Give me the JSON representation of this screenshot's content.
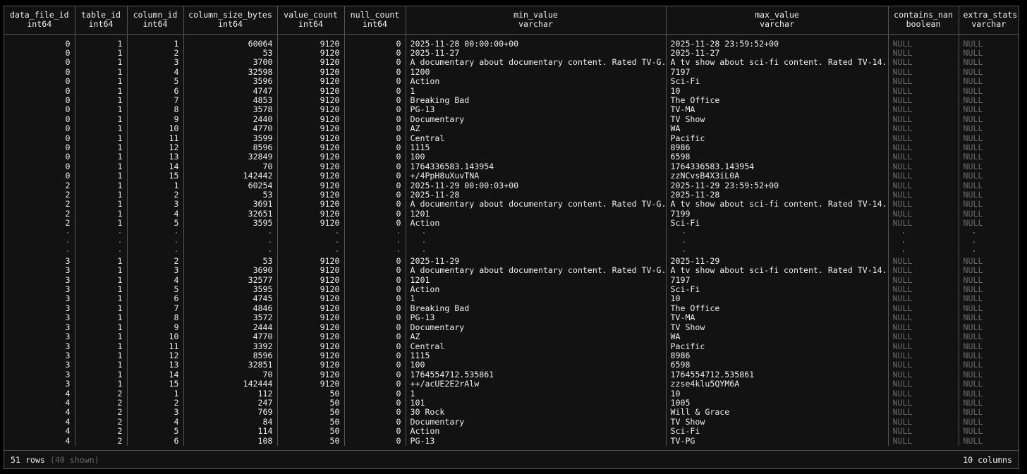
{
  "columns": [
    {
      "name": "data_file_id",
      "type": "int64",
      "align": "num"
    },
    {
      "name": "table_id",
      "type": "int64",
      "align": "num"
    },
    {
      "name": "column_id",
      "type": "int64",
      "align": "num"
    },
    {
      "name": "column_size_bytes",
      "type": "int64",
      "align": "num"
    },
    {
      "name": "value_count",
      "type": "int64",
      "align": "num"
    },
    {
      "name": "null_count",
      "type": "int64",
      "align": "num"
    },
    {
      "name": "min_value",
      "type": "varchar",
      "align": "txt"
    },
    {
      "name": "max_value",
      "type": "varchar",
      "align": "txt"
    },
    {
      "name": "contains_nan",
      "type": "boolean",
      "align": "null"
    },
    {
      "name": "extra_stats",
      "type": "varchar",
      "align": "null"
    }
  ],
  "rows_top": [
    [
      "0",
      "1",
      "1",
      "60064",
      "9120",
      "0",
      "2025-11-28 00:00:00+00",
      "2025-11-28 23:59:52+00",
      "NULL",
      "NULL"
    ],
    [
      "0",
      "1",
      "2",
      "53",
      "9120",
      "0",
      "2025-11-27",
      "2025-11-27",
      "NULL",
      "NULL"
    ],
    [
      "0",
      "1",
      "3",
      "3700",
      "9120",
      "0",
      "A documentary about documentary content. Rated TV-G.",
      "A tv show about sci-fi content. Rated TV-14.",
      "NULL",
      "NULL"
    ],
    [
      "0",
      "1",
      "4",
      "32598",
      "9120",
      "0",
      "1200",
      "7197",
      "NULL",
      "NULL"
    ],
    [
      "0",
      "1",
      "5",
      "3596",
      "9120",
      "0",
      "Action",
      "Sci-Fi",
      "NULL",
      "NULL"
    ],
    [
      "0",
      "1",
      "6",
      "4747",
      "9120",
      "0",
      "1",
      "10",
      "NULL",
      "NULL"
    ],
    [
      "0",
      "1",
      "7",
      "4853",
      "9120",
      "0",
      "Breaking Bad",
      "The Office",
      "NULL",
      "NULL"
    ],
    [
      "0",
      "1",
      "8",
      "3578",
      "9120",
      "0",
      "PG-13",
      "TV-MA",
      "NULL",
      "NULL"
    ],
    [
      "0",
      "1",
      "9",
      "2440",
      "9120",
      "0",
      "Documentary",
      "TV Show",
      "NULL",
      "NULL"
    ],
    [
      "0",
      "1",
      "10",
      "4770",
      "9120",
      "0",
      "AZ",
      "WA",
      "NULL",
      "NULL"
    ],
    [
      "0",
      "1",
      "11",
      "3599",
      "9120",
      "0",
      "Central",
      "Pacific",
      "NULL",
      "NULL"
    ],
    [
      "0",
      "1",
      "12",
      "8596",
      "9120",
      "0",
      "1115",
      "8986",
      "NULL",
      "NULL"
    ],
    [
      "0",
      "1",
      "13",
      "32849",
      "9120",
      "0",
      "100",
      "6598",
      "NULL",
      "NULL"
    ],
    [
      "0",
      "1",
      "14",
      "70",
      "9120",
      "0",
      "1764336583.143954",
      "1764336583.143954",
      "NULL",
      "NULL"
    ],
    [
      "0",
      "1",
      "15",
      "142442",
      "9120",
      "0",
      "+/4PpH8uXuvTNA",
      "zzNCvsB4X3iL0A",
      "NULL",
      "NULL"
    ],
    [
      "2",
      "1",
      "1",
      "60254",
      "9120",
      "0",
      "2025-11-29 00:00:03+00",
      "2025-11-29 23:59:52+00",
      "NULL",
      "NULL"
    ],
    [
      "2",
      "1",
      "2",
      "53",
      "9120",
      "0",
      "2025-11-28",
      "2025-11-28",
      "NULL",
      "NULL"
    ],
    [
      "2",
      "1",
      "3",
      "3691",
      "9120",
      "0",
      "A documentary about documentary content. Rated TV-G.",
      "A tv show about sci-fi content. Rated TV-14.",
      "NULL",
      "NULL"
    ],
    [
      "2",
      "1",
      "4",
      "32651",
      "9120",
      "0",
      "1201",
      "7199",
      "NULL",
      "NULL"
    ],
    [
      "2",
      "1",
      "5",
      "3595",
      "9120",
      "0",
      "Action",
      "Sci-Fi",
      "NULL",
      "NULL"
    ]
  ],
  "ellipsis_rows": 3,
  "ellipsis_char": "·",
  "rows_bottom": [
    [
      "3",
      "1",
      "2",
      "53",
      "9120",
      "0",
      "2025-11-29",
      "2025-11-29",
      "NULL",
      "NULL"
    ],
    [
      "3",
      "1",
      "3",
      "3690",
      "9120",
      "0",
      "A documentary about documentary content. Rated TV-G.",
      "A tv show about sci-fi content. Rated TV-14.",
      "NULL",
      "NULL"
    ],
    [
      "3",
      "1",
      "4",
      "32577",
      "9120",
      "0",
      "1201",
      "7197",
      "NULL",
      "NULL"
    ],
    [
      "3",
      "1",
      "5",
      "3595",
      "9120",
      "0",
      "Action",
      "Sci-Fi",
      "NULL",
      "NULL"
    ],
    [
      "3",
      "1",
      "6",
      "4745",
      "9120",
      "0",
      "1",
      "10",
      "NULL",
      "NULL"
    ],
    [
      "3",
      "1",
      "7",
      "4846",
      "9120",
      "0",
      "Breaking Bad",
      "The Office",
      "NULL",
      "NULL"
    ],
    [
      "3",
      "1",
      "8",
      "3572",
      "9120",
      "0",
      "PG-13",
      "TV-MA",
      "NULL",
      "NULL"
    ],
    [
      "3",
      "1",
      "9",
      "2444",
      "9120",
      "0",
      "Documentary",
      "TV Show",
      "NULL",
      "NULL"
    ],
    [
      "3",
      "1",
      "10",
      "4770",
      "9120",
      "0",
      "AZ",
      "WA",
      "NULL",
      "NULL"
    ],
    [
      "3",
      "1",
      "11",
      "3392",
      "9120",
      "0",
      "Central",
      "Pacific",
      "NULL",
      "NULL"
    ],
    [
      "3",
      "1",
      "12",
      "8596",
      "9120",
      "0",
      "1115",
      "8986",
      "NULL",
      "NULL"
    ],
    [
      "3",
      "1",
      "13",
      "32851",
      "9120",
      "0",
      "100",
      "6598",
      "NULL",
      "NULL"
    ],
    [
      "3",
      "1",
      "14",
      "70",
      "9120",
      "0",
      "1764554712.535861",
      "1764554712.535861",
      "NULL",
      "NULL"
    ],
    [
      "3",
      "1",
      "15",
      "142444",
      "9120",
      "0",
      "++/acUE2E2rAlw",
      "zzse4klu5QYM6A",
      "NULL",
      "NULL"
    ],
    [
      "4",
      "2",
      "1",
      "112",
      "50",
      "0",
      "1",
      "10",
      "NULL",
      "NULL"
    ],
    [
      "4",
      "2",
      "2",
      "247",
      "50",
      "0",
      "101",
      "1005",
      "NULL",
      "NULL"
    ],
    [
      "4",
      "2",
      "3",
      "769",
      "50",
      "0",
      "30 Rock",
      "Will & Grace",
      "NULL",
      "NULL"
    ],
    [
      "4",
      "2",
      "4",
      "84",
      "50",
      "0",
      "Documentary",
      "TV Show",
      "NULL",
      "NULL"
    ],
    [
      "4",
      "2",
      "5",
      "114",
      "50",
      "0",
      "Action",
      "Sci-Fi",
      "NULL",
      "NULL"
    ],
    [
      "4",
      "2",
      "6",
      "108",
      "50",
      "0",
      "PG-13",
      "TV-PG",
      "NULL",
      "NULL"
    ]
  ],
  "footer": {
    "row_count": "51 rows",
    "shown": "(40 shown)",
    "column_count": "10 columns"
  },
  "colors": {
    "background": "#121212",
    "border": "#555555",
    "text": "#eeeeee",
    "muted": "#6a6a6a"
  }
}
